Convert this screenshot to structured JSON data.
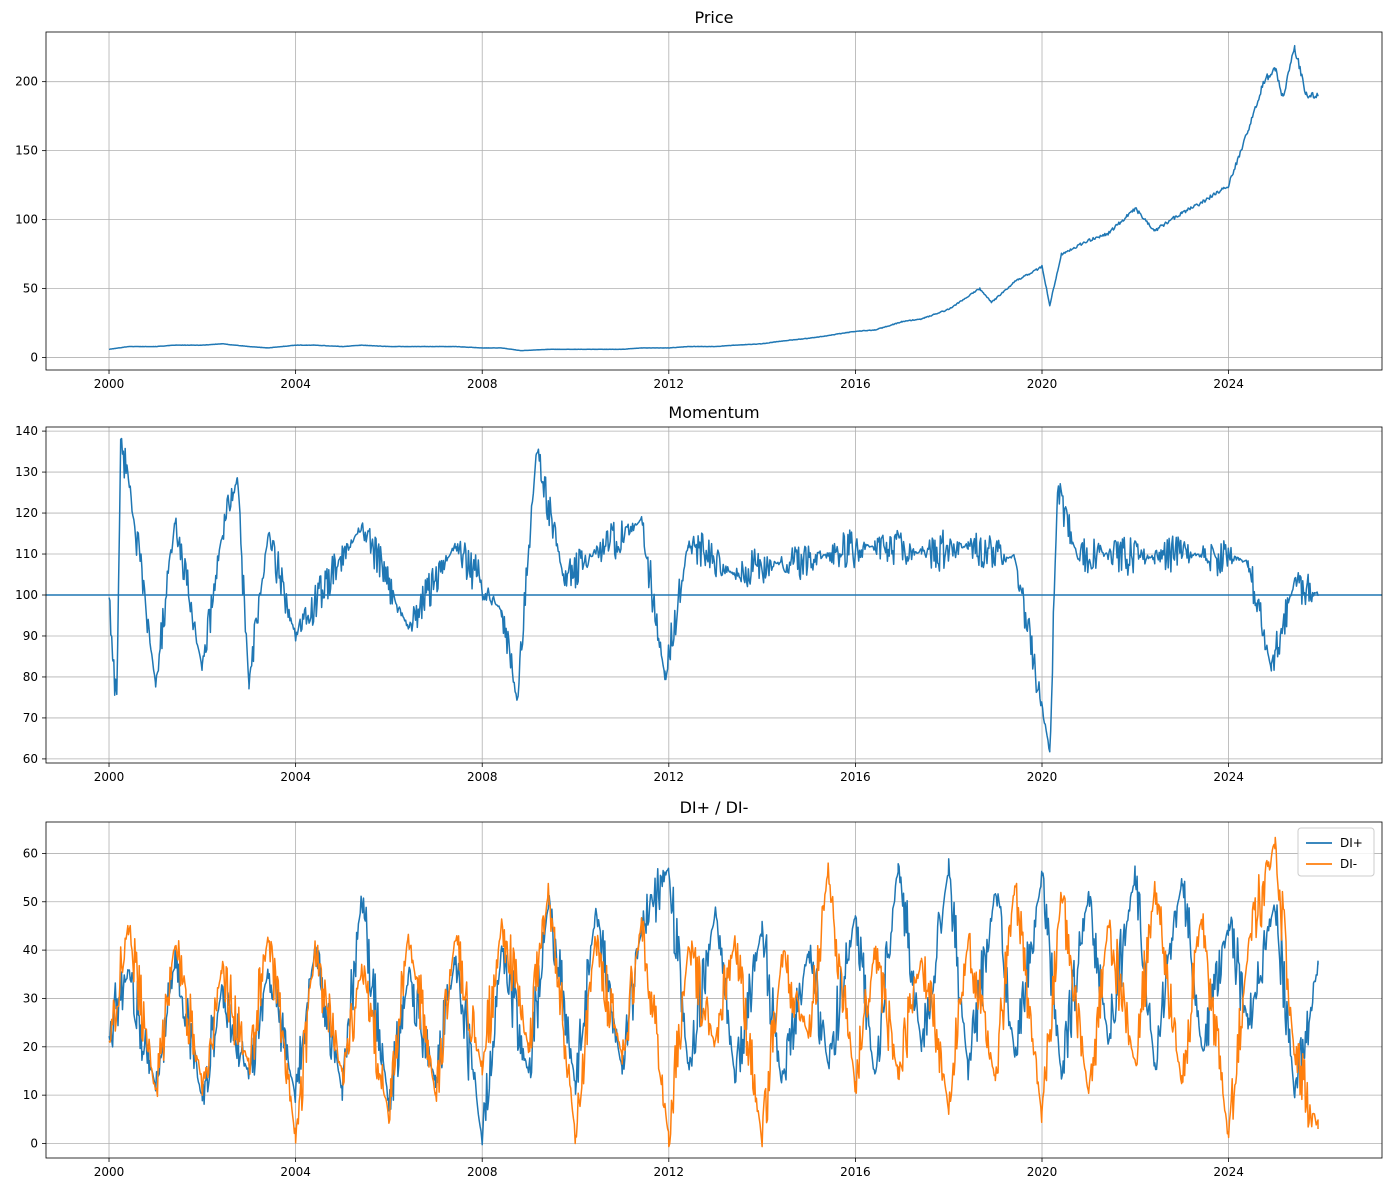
{
  "chart_data": [
    {
      "type": "line",
      "title": "Price",
      "xlabel": "",
      "ylabel": "",
      "x_range": [
        "1998-08-25",
        "2027-04-15"
      ],
      "ylim": [
        -9,
        236
      ],
      "x_ticks": [
        "2000",
        "2004",
        "2008",
        "2012",
        "2016",
        "2020",
        "2024"
      ],
      "y_ticks": [
        0,
        50,
        100,
        150,
        200
      ],
      "grid": true,
      "legend": "none",
      "series": [
        {
          "color": "#1f77b4",
          "x": [
            "2000-01",
            "2000-06",
            "2001-01",
            "2001-06",
            "2002-01",
            "2002-06",
            "2003-01",
            "2003-06",
            "2004-01",
            "2004-06",
            "2005-01",
            "2005-06",
            "2006-01",
            "2006-06",
            "2007-01",
            "2007-06",
            "2008-01",
            "2008-06",
            "2008-11",
            "2009-06",
            "2010-01",
            "2010-06",
            "2011-01",
            "2011-06",
            "2012-01",
            "2012-06",
            "2013-01",
            "2013-06",
            "2014-01",
            "2014-06",
            "2015-01",
            "2015-06",
            "2016-01",
            "2016-06",
            "2017-01",
            "2017-06",
            "2018-01",
            "2018-09",
            "2018-12",
            "2019-06",
            "2020-01",
            "2020-03",
            "2020-06",
            "2021-01",
            "2021-06",
            "2022-01",
            "2022-06",
            "2023-01",
            "2023-06",
            "2024-01",
            "2024-06",
            "2024-10",
            "2025-01",
            "2025-03",
            "2025-06",
            "2025-09",
            "2025-12"
          ],
          "y": [
            6,
            8,
            8,
            9,
            9,
            10,
            8,
            7,
            9,
            9,
            8,
            9,
            8,
            8,
            8,
            8,
            7,
            7,
            5,
            6,
            6,
            6,
            6,
            7,
            7,
            8,
            8,
            9,
            10,
            12,
            14,
            16,
            19,
            20,
            26,
            28,
            35,
            50,
            40,
            55,
            66,
            38,
            75,
            85,
            90,
            108,
            92,
            105,
            112,
            125,
            165,
            200,
            210,
            188,
            225,
            190,
            190
          ]
        }
      ]
    },
    {
      "type": "line",
      "title": "Momentum",
      "xlabel": "",
      "ylabel": "",
      "x_range": [
        "1998-08-25",
        "2027-04-15"
      ],
      "ylim": [
        59,
        141
      ],
      "x_ticks": [
        "2000",
        "2004",
        "2008",
        "2012",
        "2016",
        "2020",
        "2024"
      ],
      "y_ticks": [
        60,
        70,
        80,
        90,
        100,
        110,
        120,
        130,
        140
      ],
      "grid": true,
      "legend": "none",
      "reference_line": 100,
      "series": [
        {
          "color": "#1f77b4",
          "x": [
            "2000-01",
            "2000-02",
            "2000-03",
            "2000-04",
            "2000-06",
            "2001-01",
            "2001-06",
            "2002-01",
            "2002-06",
            "2002-10",
            "2003-01",
            "2003-06",
            "2004-01",
            "2005-06",
            "2006-06",
            "2007-06",
            "2008-06",
            "2008-10",
            "2009-03",
            "2009-10",
            "2010-06",
            "2011-06",
            "2011-12",
            "2012-06",
            "2013-06",
            "2014-06",
            "2015-06",
            "2016-06",
            "2017-06",
            "2018-06",
            "2019-06",
            "2020-03",
            "2020-05",
            "2020-10",
            "2021-06",
            "2022-06",
            "2023-06",
            "2024-06",
            "2024-12",
            "2025-06",
            "2025-12"
          ],
          "y": [
            100,
            83,
            76,
            137,
            129,
            78,
            118,
            82,
            115,
            128,
            78,
            115,
            90,
            117,
            92,
            112,
            96,
            74,
            136,
            104,
            110,
            118,
            80,
            113,
            105,
            108,
            110,
            112,
            110,
            112,
            109,
            62,
            126,
            110,
            110,
            109,
            110,
            108,
            82,
            103,
            100
          ]
        }
      ]
    },
    {
      "type": "line",
      "title": "DI+ / DI-",
      "xlabel": "",
      "ylabel": "",
      "x_range": [
        "1998-08-25",
        "2027-04-15"
      ],
      "ylim": [
        -3,
        66.5
      ],
      "x_ticks": [
        "2000",
        "2004",
        "2008",
        "2012",
        "2016",
        "2020",
        "2024"
      ],
      "y_ticks": [
        0,
        10,
        20,
        30,
        40,
        50,
        60
      ],
      "grid": true,
      "legend": "top-right",
      "series": [
        {
          "name": "DI+",
          "color": "#1f77b4",
          "x": [
            "2000-01",
            "2000-06",
            "2001-01",
            "2001-06",
            "2002-01",
            "2002-06",
            "2003-01",
            "2003-06",
            "2004-01",
            "2004-06",
            "2005-01",
            "2005-06",
            "2006-01",
            "2006-06",
            "2007-01",
            "2007-06",
            "2008-01",
            "2008-06",
            "2009-01",
            "2009-06",
            "2010-01",
            "2010-06",
            "2011-01",
            "2011-06",
            "2012-01",
            "2012-06",
            "2013-01",
            "2013-06",
            "2014-01",
            "2014-06",
            "2015-01",
            "2015-06",
            "2016-01",
            "2016-06",
            "2016-12",
            "2017-06",
            "2018-01",
            "2018-06",
            "2019-01",
            "2019-06",
            "2020-01",
            "2020-06",
            "2021-01",
            "2021-06",
            "2022-01",
            "2022-06",
            "2023-01",
            "2023-06",
            "2024-01",
            "2024-06",
            "2025-01",
            "2025-06",
            "2025-12"
          ],
          "y": [
            23,
            35,
            12,
            38,
            9,
            32,
            14,
            36,
            10,
            40,
            11,
            51,
            8,
            35,
            13,
            38,
            1,
            40,
            14,
            50,
            12,
            47,
            15,
            45,
            57,
            16,
            48,
            14,
            45,
            12,
            40,
            16,
            48,
            13,
            58,
            20,
            57,
            15,
            52,
            18,
            55,
            14,
            52,
            22,
            56,
            16,
            55,
            20,
            45,
            25,
            50,
            10,
            37
          ]
        },
        {
          "name": "DI-",
          "color": "#ff7f0e",
          "x": [
            "2000-01",
            "2000-06",
            "2001-01",
            "2001-06",
            "2002-01",
            "2002-06",
            "2003-01",
            "2003-06",
            "2004-01",
            "2004-06",
            "2005-01",
            "2005-06",
            "2006-01",
            "2006-06",
            "2007-01",
            "2007-06",
            "2008-01",
            "2008-06",
            "2009-01",
            "2009-06",
            "2010-01",
            "2010-06",
            "2011-01",
            "2011-06",
            "2012-01",
            "2012-06",
            "2013-01",
            "2013-06",
            "2014-01",
            "2014-06",
            "2015-01",
            "2015-06",
            "2016-01",
            "2016-06",
            "2016-12",
            "2017-06",
            "2018-01",
            "2018-06",
            "2019-01",
            "2019-06",
            "2020-01",
            "2020-06",
            "2021-01",
            "2021-06",
            "2022-01",
            "2022-06",
            "2023-01",
            "2023-06",
            "2024-01",
            "2024-06",
            "2025-01",
            "2025-06",
            "2025-12"
          ],
          "y": [
            22,
            45,
            10,
            42,
            12,
            36,
            16,
            43,
            1,
            40,
            14,
            36,
            6,
            44,
            10,
            42,
            15,
            45,
            20,
            52,
            1,
            42,
            18,
            46,
            1,
            40,
            20,
            42,
            1,
            38,
            22,
            57,
            12,
            40,
            14,
            38,
            8,
            42,
            13,
            54,
            5,
            52,
            10,
            45,
            16,
            53,
            12,
            48,
            1,
            40,
            63,
            18,
            3
          ]
        }
      ]
    }
  ]
}
